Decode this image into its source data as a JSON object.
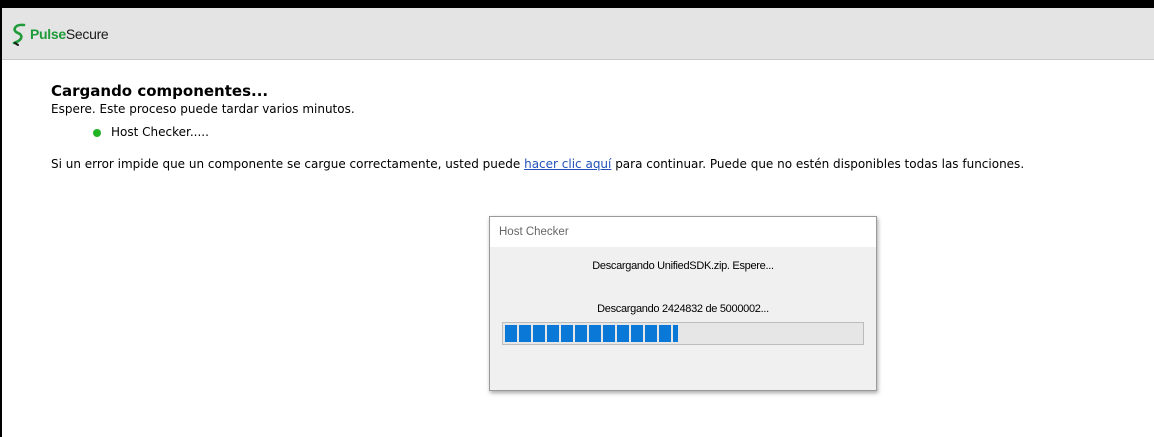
{
  "header": {
    "logo_part1": "Pulse",
    "logo_part2": "Secure",
    "logo_color": "#1f9b3a"
  },
  "main": {
    "title": "Cargando componentes...",
    "subtitle": "Espere. Este proceso puede tardar varios minutos.",
    "component_status": {
      "label": "Host Checker.....",
      "status_color": "#22b322"
    },
    "notice": {
      "before": "Si un error impide que un componente se cargue correctamente, usted puede ",
      "link_text": "hacer clic aquí",
      "after": " para continuar. Puede que no estén disponibles todas las funciones."
    }
  },
  "dialog": {
    "title": "Host Checker",
    "message": "Descargando UnifiedSDK.zip. Espere...",
    "progress_text": "Descargando 2424832 de 5000002...",
    "progress_fraction": 0.485,
    "accent_color": "#0a78d7"
  }
}
